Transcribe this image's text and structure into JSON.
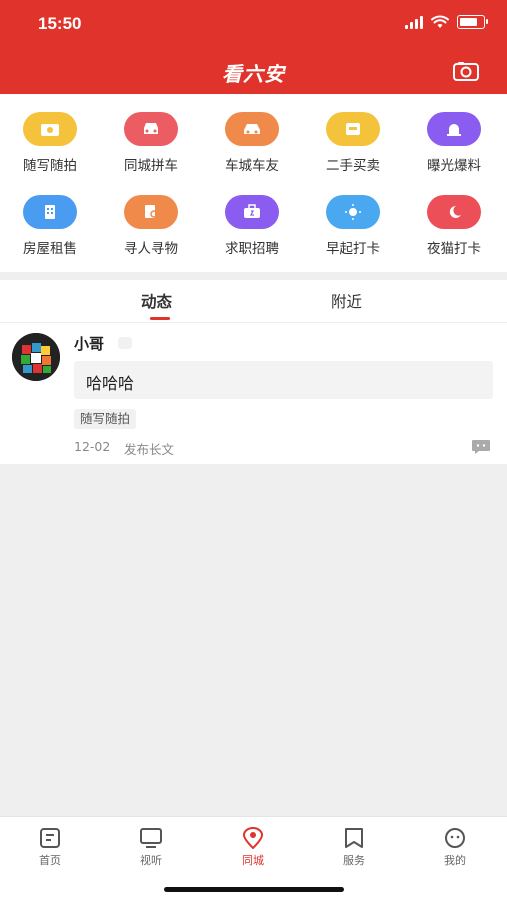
{
  "status_bar": {
    "time": "15:50",
    "battery_level": 0.85
  },
  "header": {
    "title": "看六安",
    "camera_icon": "camera-icon"
  },
  "categories": [
    {
      "label": "随写随拍",
      "icon": "camera-icon",
      "color": "#f5c33b"
    },
    {
      "label": "同城拼车",
      "icon": "car-icon",
      "color": "#ec5d63"
    },
    {
      "label": "车城车友",
      "icon": "car-icon",
      "color": "#f08a4b"
    },
    {
      "label": "二手买卖",
      "icon": "shop-icon",
      "color": "#f5c33b"
    },
    {
      "label": "曝光爆料",
      "icon": "alarm-icon",
      "color": "#8a5cf0"
    },
    {
      "label": "房屋租售",
      "icon": "building-icon",
      "color": "#4a9cf0"
    },
    {
      "label": "寻人寻物",
      "icon": "search-doc-icon",
      "color": "#f08a4b"
    },
    {
      "label": "求职招聘",
      "icon": "briefcase-icon",
      "color": "#8a5cf0"
    },
    {
      "label": "早起打卡",
      "icon": "sun-icon",
      "color": "#4aa8f0"
    },
    {
      "label": "夜猫打卡",
      "icon": "moon-icon",
      "color": "#ec4f57"
    }
  ],
  "tabs": [
    {
      "label": "动态",
      "active": true
    },
    {
      "label": "附近",
      "active": false
    }
  ],
  "post": {
    "username": "小哥",
    "content": "哈哈哈",
    "category": "随写随拍",
    "date": "12-02",
    "action": "发布长文"
  },
  "bottom_nav": [
    {
      "label": "首页",
      "icon": "home-doc-icon",
      "active": false
    },
    {
      "label": "视听",
      "icon": "tv-icon",
      "active": false
    },
    {
      "label": "同城",
      "icon": "location-icon",
      "active": true
    },
    {
      "label": "服务",
      "icon": "bookmark-icon",
      "active": false
    },
    {
      "label": "我的",
      "icon": "profile-face-icon",
      "active": false
    }
  ],
  "colors": {
    "brand_red": "#e0332b",
    "background": "#efefef"
  }
}
